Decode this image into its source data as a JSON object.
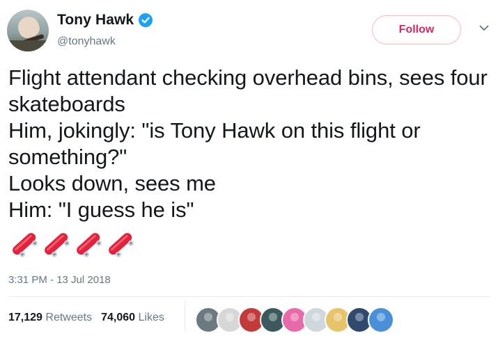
{
  "author": {
    "display_name": "Tony Hawk",
    "handle": "@tonyhawk",
    "verified": true
  },
  "follow_button": {
    "label": "Follow",
    "color": "#e0245e"
  },
  "tweet": {
    "text": "Flight attendant checking overhead bins, sees four skateboards\nHim, jokingly: \"is Tony Hawk on this flight or something?\"\nLooks down, sees me\nHim: \"I guess he is\"",
    "emoji": [
      "skateboard",
      "skateboard",
      "skateboard",
      "skateboard"
    ],
    "timestamp": "3:31 PM - 13 Jul 2018"
  },
  "stats": {
    "retweets_count": "17,129",
    "retweets_label": "Retweets",
    "likes_count": "74,060",
    "likes_label": "Likes"
  },
  "likers": [
    {
      "color": "#6b7a80"
    },
    {
      "color": "#d7d7d7"
    },
    {
      "color": "#c23a3a"
    },
    {
      "color": "#3c5a5e"
    },
    {
      "color": "#e86aa8"
    },
    {
      "color": "#cfd8dc"
    },
    {
      "color": "#e7c36a"
    },
    {
      "color": "#2f4a6e"
    },
    {
      "color": "#4a90d9"
    }
  ],
  "colors": {
    "accent": "#1da1f2",
    "muted": "#657786",
    "text": "#14171a"
  }
}
